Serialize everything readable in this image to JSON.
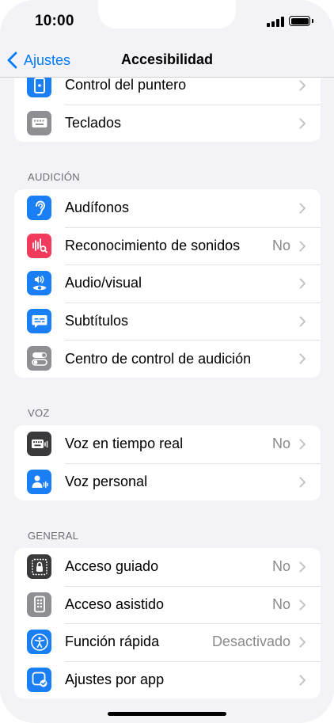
{
  "status_bar": {
    "time": "10:00",
    "signal_icon": "cellular-signal-icon",
    "battery_icon": "battery-icon"
  },
  "nav": {
    "back_label": "Ajustes",
    "title": "Accesibilidad"
  },
  "colors": {
    "accent": "#007aff",
    "blue_icon": "#1a7ef5",
    "red_icon": "#f23a5c",
    "gray_icon": "#8e8e93",
    "dark_icon": "#3a3a3c",
    "background": "#f2f2f7"
  },
  "top_group": {
    "rows": [
      {
        "label": "Control del puntero",
        "icon": "pointer-control-icon"
      },
      {
        "label": "Teclados",
        "icon": "keyboard-icon"
      }
    ]
  },
  "audicion": {
    "header": "AUDICIÓN",
    "rows": [
      {
        "label": "Audífonos",
        "icon": "ear-icon"
      },
      {
        "label": "Reconocimiento de sonidos",
        "value": "No",
        "icon": "sound-recognition-icon"
      },
      {
        "label": "Audio/visual",
        "icon": "audio-visual-icon"
      },
      {
        "label": "Subtítulos",
        "icon": "subtitles-icon"
      },
      {
        "label": "Centro de control de audición",
        "icon": "toggle-switches-icon"
      }
    ]
  },
  "voz": {
    "header": "VOZ",
    "rows": [
      {
        "label": "Voz en tiempo real",
        "value": "No",
        "icon": "live-speech-icon"
      },
      {
        "label": "Voz personal",
        "icon": "personal-voice-icon"
      }
    ]
  },
  "general": {
    "header": "GENERAL",
    "rows": [
      {
        "label": "Acceso guiado",
        "value": "No",
        "icon": "lock-icon"
      },
      {
        "label": "Acceso asistido",
        "value": "No",
        "icon": "assistive-access-icon"
      },
      {
        "label": "Función rápida",
        "value": "Desactivado",
        "icon": "accessibility-icon"
      },
      {
        "label": "Ajustes por app",
        "icon": "per-app-settings-icon"
      }
    ]
  }
}
